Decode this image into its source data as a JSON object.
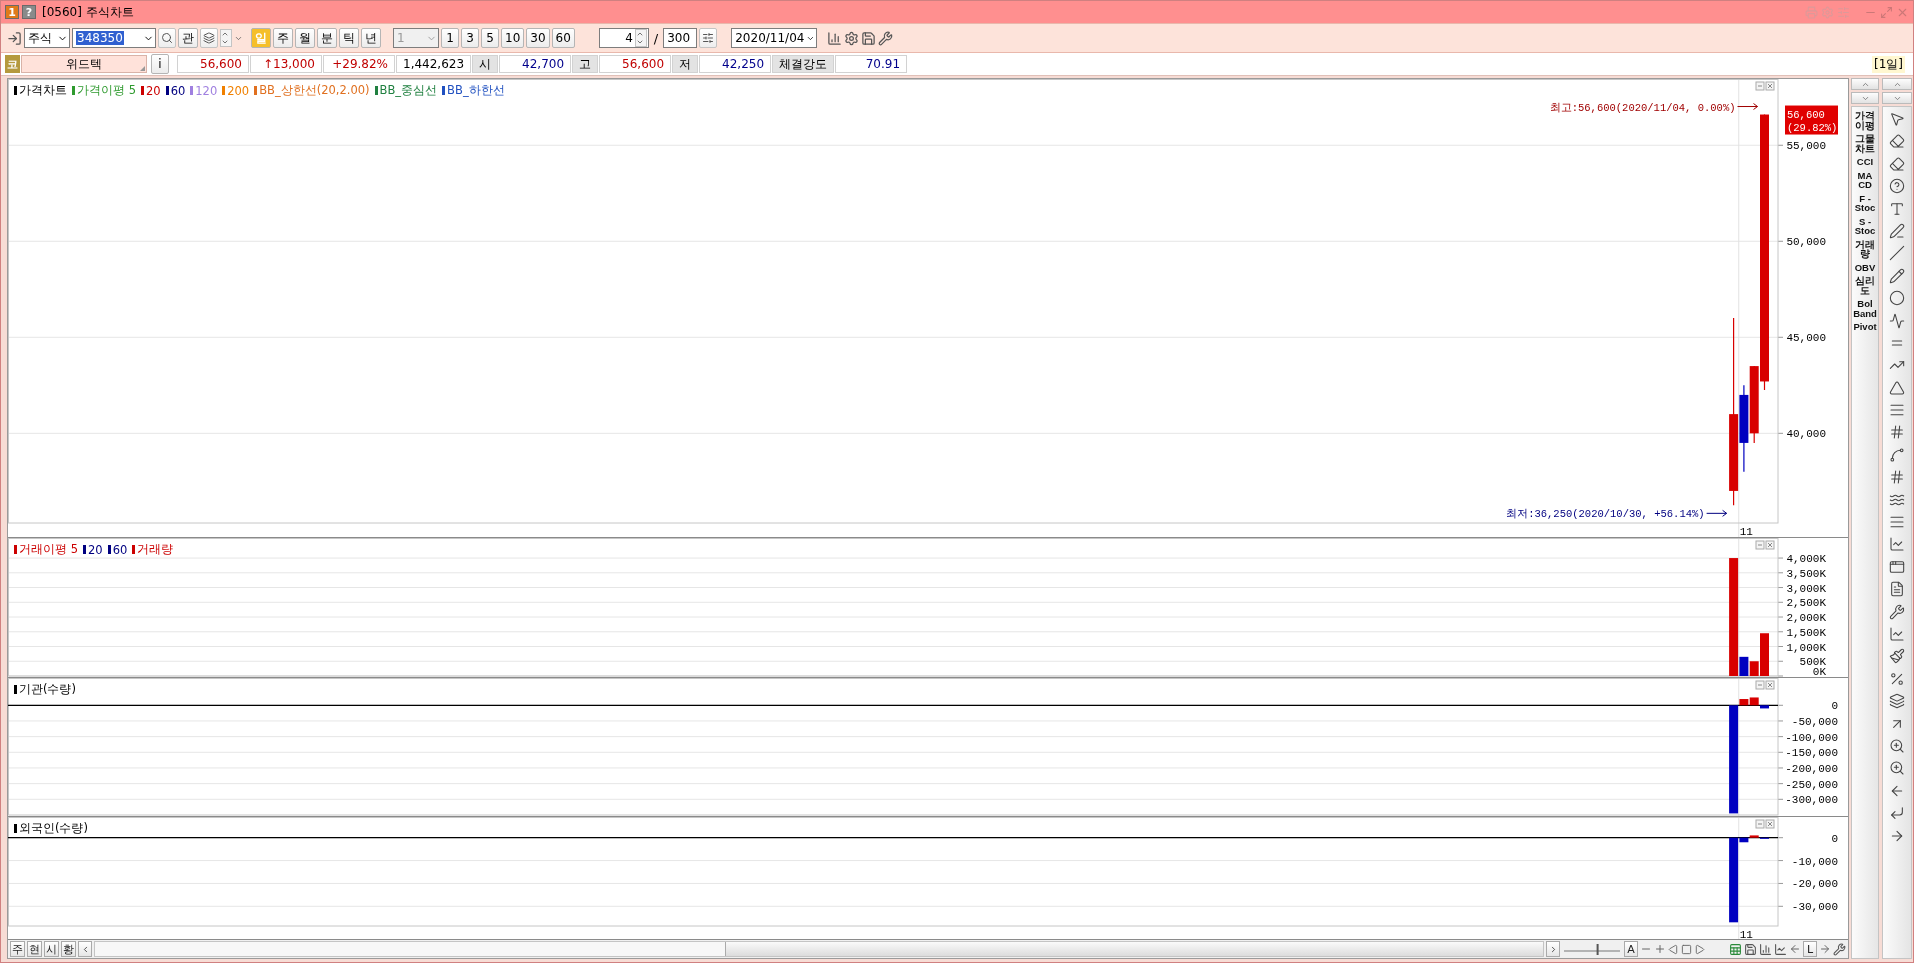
{
  "window": {
    "title": "[0560] 주식차트",
    "badges": [
      {
        "text": "1",
        "color": "#e07a1a"
      },
      {
        "text": "?",
        "color": "#8a8a8a"
      }
    ]
  },
  "toolbar": {
    "market": "주식",
    "code": "348350",
    "code_highlighted": true,
    "watch_button": "관",
    "periods": [
      {
        "label": "일",
        "selected": true
      },
      {
        "label": "주",
        "selected": false
      },
      {
        "label": "월",
        "selected": false
      },
      {
        "label": "분",
        "selected": false
      },
      {
        "label": "틱",
        "selected": false
      },
      {
        "label": "년",
        "selected": false
      }
    ],
    "interval": "1",
    "interval_disabled": true,
    "minutes": [
      "1",
      "3",
      "5",
      "10",
      "30",
      "60"
    ],
    "count": "4",
    "separator": "/",
    "total": "300",
    "date": "2020/11/04"
  },
  "info": {
    "market_badge": "코",
    "name": "위드텍",
    "info_button": "i",
    "period": "[1일]",
    "cells": [
      {
        "kind": "value",
        "text": "56,600",
        "color": "#c00000"
      },
      {
        "kind": "value",
        "text": "↑13,000",
        "color": "#c00000"
      },
      {
        "kind": "value",
        "text": "+29.82%",
        "color": "#c00000"
      },
      {
        "kind": "value",
        "text": "1,442,623",
        "color": "#000000"
      },
      {
        "kind": "label",
        "text": "시"
      },
      {
        "kind": "value",
        "text": "42,700",
        "color": "#00008b"
      },
      {
        "kind": "label",
        "text": "고"
      },
      {
        "kind": "value",
        "text": "56,600",
        "color": "#c00000"
      },
      {
        "kind": "label",
        "text": "저"
      },
      {
        "kind": "value",
        "text": "42,250",
        "color": "#00008b"
      },
      {
        "kind": "label",
        "text": "체결강도"
      },
      {
        "kind": "value",
        "text": "70.91",
        "color": "#00008b"
      }
    ]
  },
  "panels": [
    {
      "kind": "price",
      "legend": [
        {
          "name": "가격차트",
          "color": "#000000"
        },
        {
          "name": "가격이평 5",
          "color": "#2e9a2e"
        },
        {
          "name": "20",
          "color": "#cc0000"
        },
        {
          "name": "60",
          "color": "#000080"
        },
        {
          "name": "120",
          "color": "#a080e0"
        },
        {
          "name": "200",
          "color": "#f08000"
        },
        {
          "name": "BB_상한선(20,2.00)",
          "color": "#e07020"
        },
        {
          "name": "BB_중심선",
          "color": "#208040"
        },
        {
          "name": "BB_하한선",
          "color": "#2050c0"
        }
      ],
      "price_tag": {
        "price": "56,600",
        "change": "(29.82%)"
      },
      "chart_data": {
        "type": "candlestick",
        "grid": true,
        "ylim": [
          35330,
          58450
        ],
        "categories": [
          null,
          null,
          null,
          null
        ],
        "yticks": [
          {
            "value": 40000,
            "label": "40,000"
          },
          {
            "value": 45000,
            "label": "45,000"
          },
          {
            "value": 50000,
            "label": "50,000"
          },
          {
            "value": 55000,
            "label": "55,000"
          }
        ],
        "series": [
          {
            "ohlc": [
              [
                37000,
                46000,
                36250,
                41000
              ],
              [
                42000,
                42500,
                38000,
                39500
              ],
              [
                40000,
                43500,
                39500,
                43500
              ],
              [
                42700,
                56600,
                42250,
                56600
              ]
            ]
          }
        ],
        "annotations": [
          "최고:56,600(2020/11/04, 0.00%)",
          "최저:36,250(2020/10/30, +56.14%)",
          "11"
        ]
      }
    },
    {
      "kind": "volume",
      "legend": [
        {
          "name": "거래이평 5",
          "color": "#cc0000"
        },
        {
          "name": "20",
          "color": "#000080"
        },
        {
          "name": "60",
          "color": "#000080"
        },
        {
          "name": "거래량",
          "color": "#cc0000"
        }
      ],
      "chart_data": {
        "type": "bar",
        "grid": true,
        "ylim": [
          0,
          4680
        ],
        "categories": [
          null,
          null,
          null,
          null
        ],
        "yticks": [
          {
            "value": 0,
            "label": "0K"
          },
          {
            "value": 500,
            "label": "500K"
          },
          {
            "value": 1000,
            "label": "1,000K"
          },
          {
            "value": 1500,
            "label": "1,500K"
          },
          {
            "value": 2000,
            "label": "2,000K"
          },
          {
            "value": 2500,
            "label": "2,500K"
          },
          {
            "value": 3000,
            "label": "3,000K"
          },
          {
            "value": 3500,
            "label": "3,500K"
          },
          {
            "value": 4000,
            "label": "4,000K"
          }
        ],
        "series": [
          {
            "values": [
              4000,
              650,
              500,
              1450
            ]
          }
        ]
      }
    },
    {
      "kind": "flow",
      "legend": [
        {
          "name": "기관(수량)",
          "color": "#000000"
        }
      ],
      "chart_data": {
        "type": "bar",
        "grid": true,
        "ylim": [
          -350100,
          87100
        ],
        "categories": [
          null,
          null,
          null,
          null
        ],
        "yticks": [
          {
            "value": 0,
            "label": "0"
          },
          {
            "value": -50000,
            "label": "-50,000"
          },
          {
            "value": -100000,
            "label": "-100,000"
          },
          {
            "value": -150000,
            "label": "-150,000"
          },
          {
            "value": -200000,
            "label": "-200,000"
          },
          {
            "value": -250000,
            "label": "-250,000"
          },
          {
            "value": -300000,
            "label": "-300,000"
          }
        ],
        "series": [
          {
            "values": [
              -345000,
              20000,
              25000,
              -10000
            ]
          }
        ]
      }
    },
    {
      "kind": "flow",
      "legend": [
        {
          "name": "외국인(수량)",
          "color": "#000000"
        }
      ],
      "chart_data": {
        "type": "bar",
        "grid": true,
        "ylim": [
          -38610,
          9050
        ],
        "categories": [
          null,
          null,
          null,
          null
        ],
        "yticks": [
          {
            "value": 0,
            "label": "0"
          },
          {
            "value": -10000,
            "label": "-10,000"
          },
          {
            "value": -20000,
            "label": "-20,000"
          },
          {
            "value": -30000,
            "label": "-30,000"
          }
        ],
        "series": [
          {
            "values": [
              -37000,
              -2000,
              1000,
              -500
            ]
          }
        ],
        "annotations": [
          "11"
        ]
      }
    }
  ],
  "indicators": [
    "가격\n이평",
    "그물\n차트",
    "CCI",
    "MA\nCD",
    "F -\nStoc",
    "S -\nStoc",
    "거래\n량",
    "OBV",
    "심리\n도",
    "Bol\nBand",
    "Pivot"
  ],
  "bottom_bar": {
    "tabs": [
      "주",
      "현",
      "시",
      "황"
    ],
    "font_button": "A",
    "base_button": "L",
    "zoom_slider": {
      "level": 0.6
    }
  }
}
